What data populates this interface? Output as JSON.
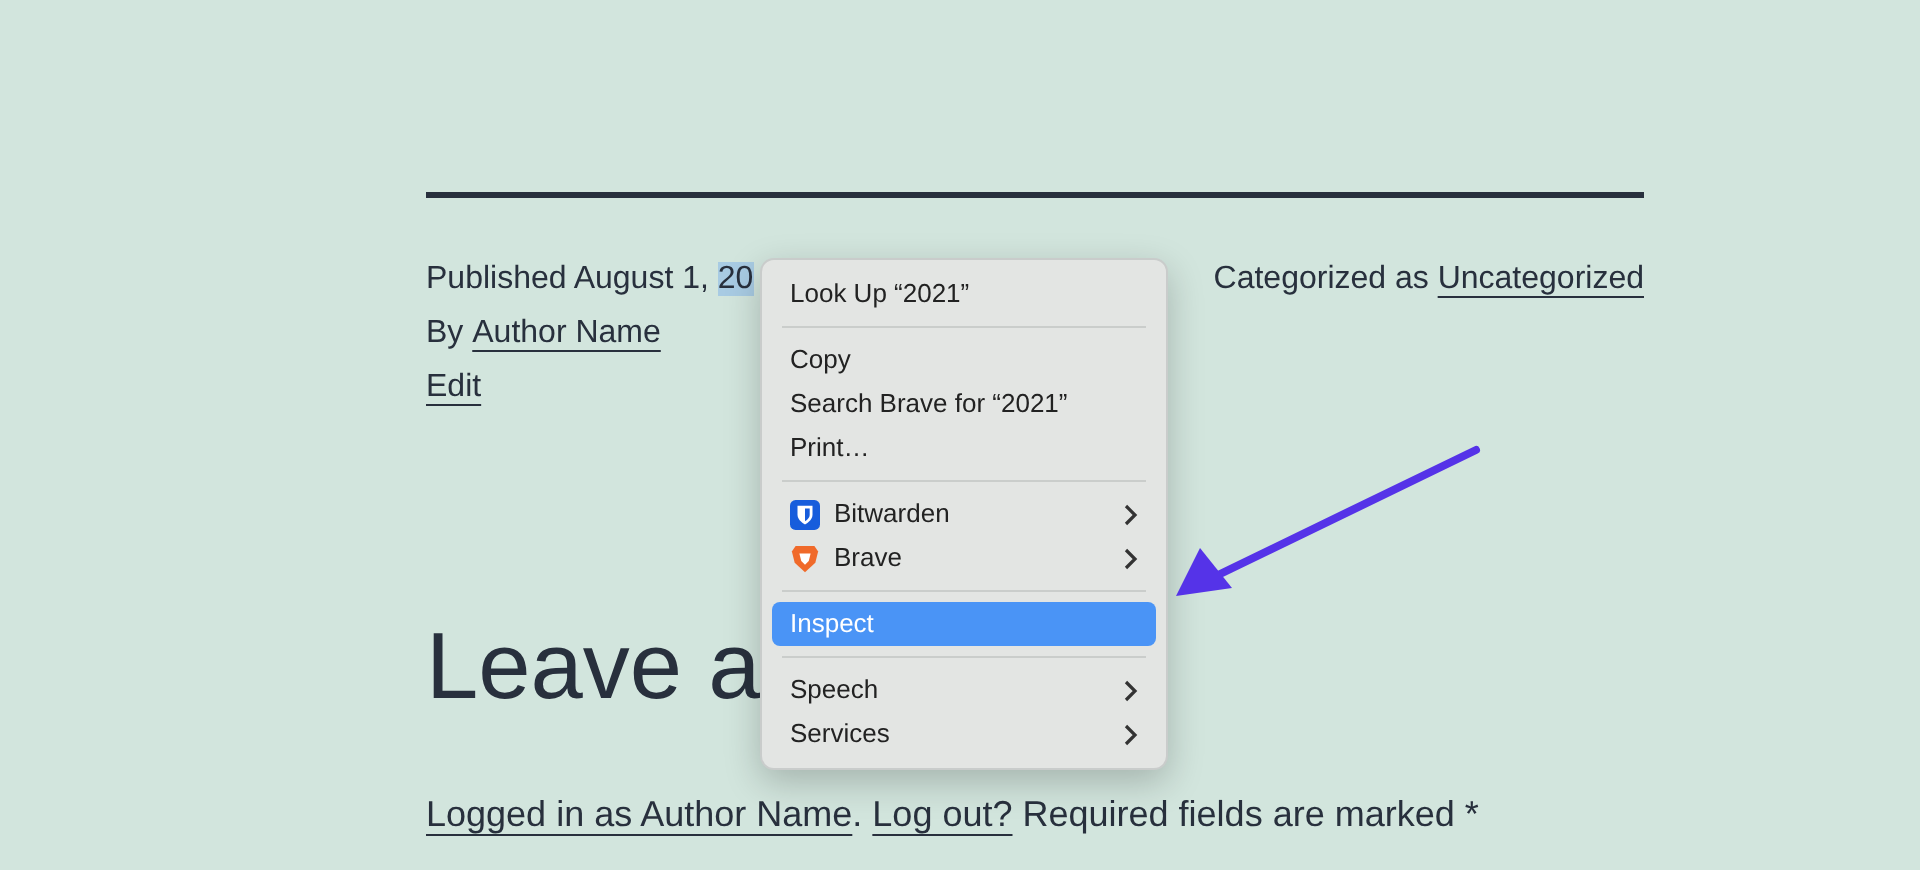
{
  "post_meta": {
    "published_label": "Published August 1, ",
    "selected_text": "20",
    "categorized_label": "Categorized as ",
    "category_link": "Uncategorized",
    "by_label": "By ",
    "author_link": "Author Name",
    "edit_link": "Edit"
  },
  "comments": {
    "heading": "Leave a",
    "logged_in_link": "Logged in as Author Name",
    "separator": ". ",
    "logout_link": "Log out?",
    "required_note": " Required fields are marked *"
  },
  "context_menu": {
    "items": [
      {
        "kind": "item",
        "label": "Look Up “2021”",
        "selected": false
      },
      {
        "kind": "separator"
      },
      {
        "kind": "item",
        "label": "Copy",
        "selected": false
      },
      {
        "kind": "item",
        "label": "Search Brave for “2021”",
        "selected": false
      },
      {
        "kind": "item",
        "label": "Print…",
        "selected": false
      },
      {
        "kind": "separator"
      },
      {
        "kind": "icon-submenu",
        "label": "Bitwarden",
        "selected": false
      },
      {
        "kind": "icon-submenu",
        "label": "Brave",
        "selected": false
      },
      {
        "kind": "separator"
      },
      {
        "kind": "item",
        "label": "Inspect",
        "selected": true
      },
      {
        "kind": "separator"
      },
      {
        "kind": "submenu",
        "label": "Speech",
        "selected": false
      },
      {
        "kind": "submenu",
        "label": "Services",
        "selected": false
      }
    ]
  }
}
